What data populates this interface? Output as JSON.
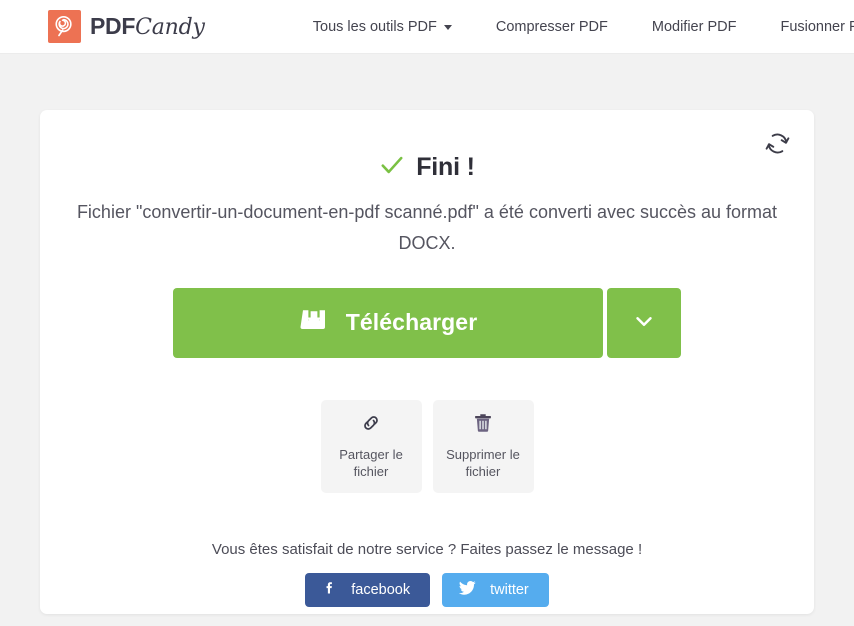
{
  "header": {
    "logo": {
      "icon": "lollipop-icon",
      "text_primary": "PDF",
      "text_secondary": "Candy",
      "mark_color": "#ed7253"
    },
    "nav": [
      {
        "label": "Tous les outils PDF",
        "has_caret": true
      },
      {
        "label": "Compresser PDF",
        "has_caret": false
      },
      {
        "label": "Modifier PDF",
        "has_caret": false
      },
      {
        "label": "Fusionner PDF",
        "has_caret": false
      }
    ]
  },
  "card": {
    "refresh_icon": "refresh-icon",
    "check_icon": "check-icon",
    "title": "Fini !",
    "subtitle": "Fichier \"convertir-un-document-en-pdf scanné.pdf\" a été converti avec succès au format DOCX.",
    "download": {
      "icon": "download-tray-icon",
      "label": "Télécharger",
      "dropdown_icon": "chevron-down-icon"
    },
    "actions": [
      {
        "icon": "link-icon",
        "label": "Partager le fichier"
      },
      {
        "icon": "trash-icon",
        "label": "Supprimer le fichier"
      }
    ],
    "share": {
      "prompt": "Vous êtes satisfait de notre service ? Faites passez le message !",
      "buttons": [
        {
          "icon": "facebook-icon",
          "label": "facebook",
          "color": "#3b5998"
        },
        {
          "icon": "twitter-icon",
          "label": "twitter",
          "color": "#55acee"
        }
      ]
    }
  },
  "colors": {
    "accent_green": "#80c04a",
    "brand_orange": "#ed7253",
    "page_bg": "#f2f2f2",
    "card_bg": "#ffffff"
  }
}
